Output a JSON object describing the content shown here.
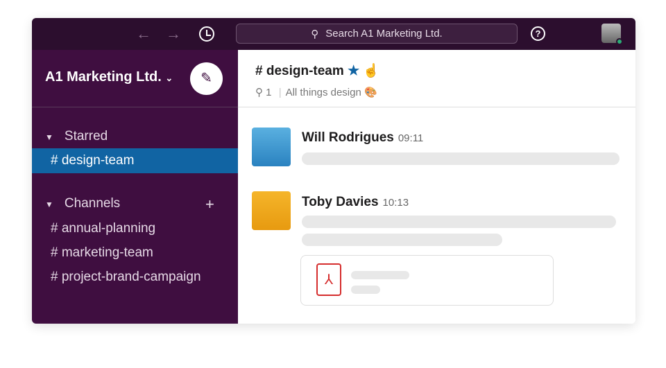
{
  "topbar": {
    "search_placeholder": "Search A1 Marketing Ltd.",
    "back": "←",
    "forward": "→",
    "help": "?"
  },
  "sidebar": {
    "workspace": "A1 Marketing Ltd.",
    "starred_label": "Starred",
    "channels_label": "Channels",
    "starred": [
      {
        "label": "design-team",
        "selected": true
      }
    ],
    "channels": [
      {
        "label": "annual-planning"
      },
      {
        "label": "marketing-team"
      },
      {
        "label": "project-brand-campaign"
      }
    ]
  },
  "channel": {
    "name": "design-team",
    "pins": "1",
    "topic": "All things design 🎨"
  },
  "messages": [
    {
      "author": "Will Rodrigues",
      "time": "09:11"
    },
    {
      "author": "Toby Davies",
      "time": "10:13"
    }
  ],
  "colors": {
    "sidebar": "#3f0e40",
    "topbar": "#2c0e2e",
    "selected": "#1164a3"
  }
}
